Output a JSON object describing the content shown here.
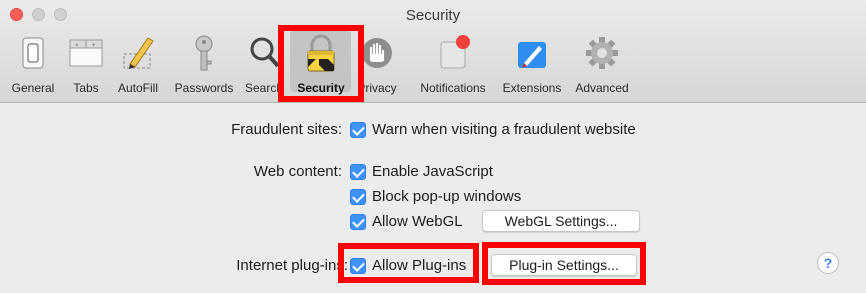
{
  "window": {
    "title": "Security"
  },
  "toolbar": {
    "items": [
      {
        "label": "General",
        "icon": "general-switch-icon"
      },
      {
        "label": "Tabs",
        "icon": "tabs-icon"
      },
      {
        "label": "AutoFill",
        "icon": "autofill-pencil-icon"
      },
      {
        "label": "Passwords",
        "icon": "key-icon"
      },
      {
        "label": "Search",
        "icon": "magnifier-icon"
      },
      {
        "label": "Security",
        "icon": "padlock-icon"
      },
      {
        "label": "Privacy",
        "icon": "hand-icon"
      },
      {
        "label": "Notifications",
        "icon": "notification-badge-icon"
      },
      {
        "label": "Extensions",
        "icon": "extensions-puzzle-icon"
      },
      {
        "label": "Advanced",
        "icon": "gear-icon"
      }
    ],
    "selected": "Security"
  },
  "settings": {
    "fraudulent": {
      "label": "Fraudulent sites:",
      "option": "Warn when visiting a fraudulent website",
      "checked": true
    },
    "web_content": {
      "label": "Web content:",
      "options": [
        {
          "text": "Enable JavaScript",
          "checked": true
        },
        {
          "text": "Block pop-up windows",
          "checked": true
        },
        {
          "text": "Allow WebGL",
          "checked": true
        }
      ],
      "webgl_button": "WebGL Settings..."
    },
    "plugins": {
      "label": "Internet plug-ins:",
      "option": "Allow Plug-ins",
      "checked": true,
      "button": "Plug-in Settings..."
    }
  },
  "help": {
    "label": "?"
  },
  "colors": {
    "highlight": "#ff0000",
    "checkbox": "#3d93fb",
    "close": "#fc5f57"
  }
}
